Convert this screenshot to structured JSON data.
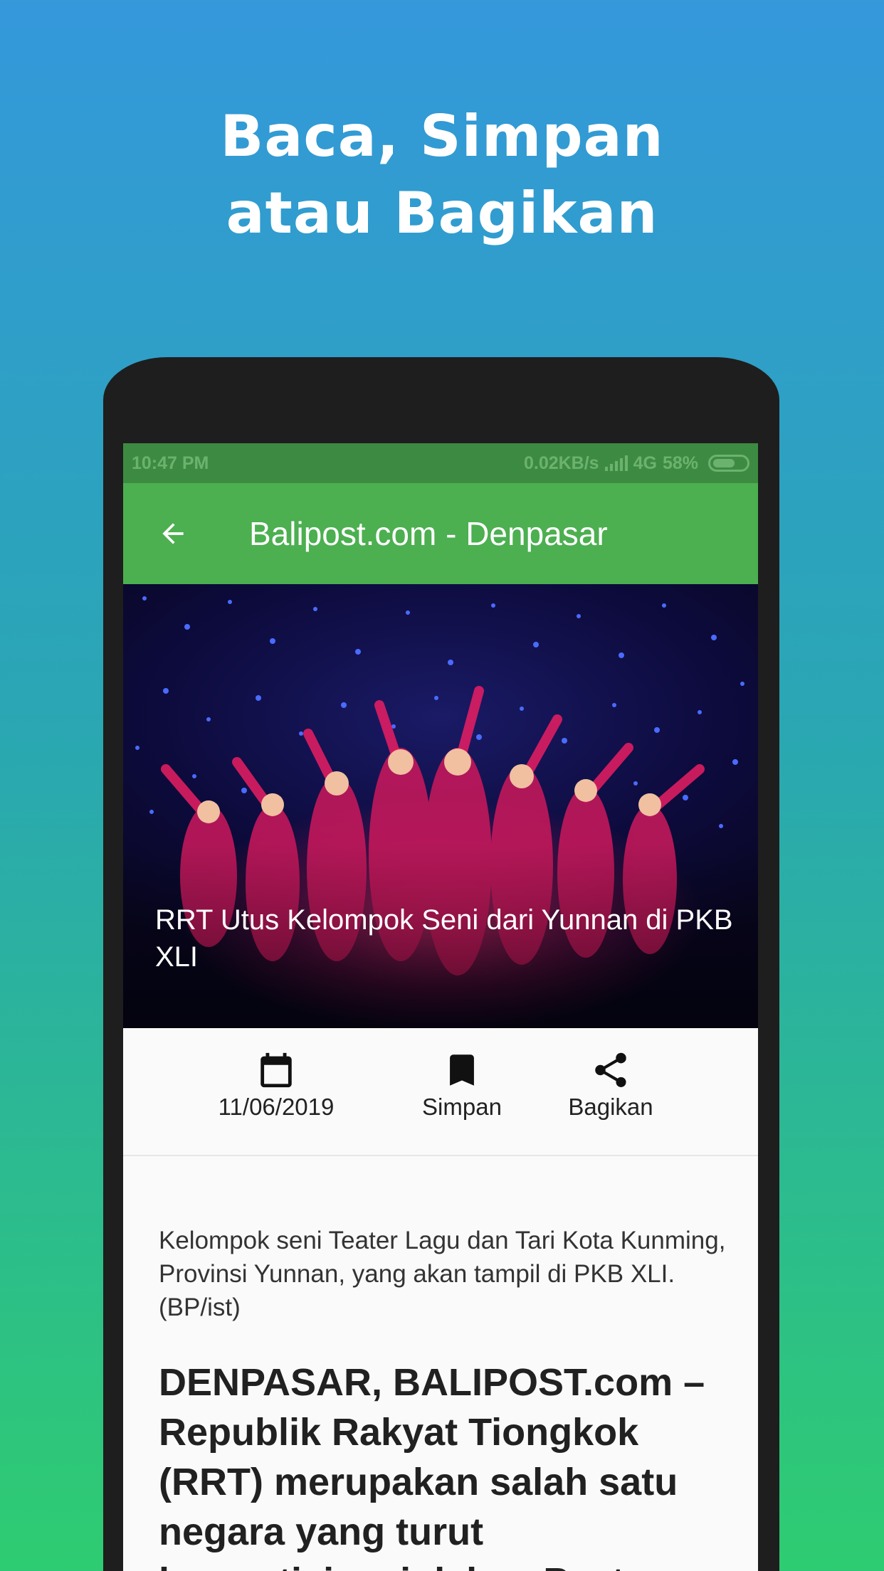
{
  "promo": {
    "headline_line1": "Baca, Simpan",
    "headline_line2": "atau Bagikan"
  },
  "status_bar": {
    "time": "10:47 PM",
    "network_speed": "0.02KB/s",
    "network_type": "4G",
    "battery": "58%"
  },
  "app_bar": {
    "back_icon": "arrow-left-icon",
    "title": "Balipost.com - Denpasar"
  },
  "article": {
    "image_description_icon": "dancers-photo",
    "title": "RRT Utus Kelompok Seni dari Yunnan di PKB XLI",
    "date": "11/06/2019",
    "save_label": "Simpan",
    "share_label": "Bagikan",
    "caption": "Kelompok seni Teater Lagu dan Tari Kota Kunming, Provinsi Yunnan, yang akan tampil di PKB XLI. (BP/ist)",
    "lead": "DENPASAR, BALIPOST.com – Republik Rakyat Tiongkok (RRT) merupakan salah satu negara yang turut berpartisipasi dalam Pesta"
  },
  "colors": {
    "appbar": "#4caf50",
    "statusbar": "#3d8b42",
    "background_top": "#3498db",
    "background_bottom": "#2ecc71"
  }
}
